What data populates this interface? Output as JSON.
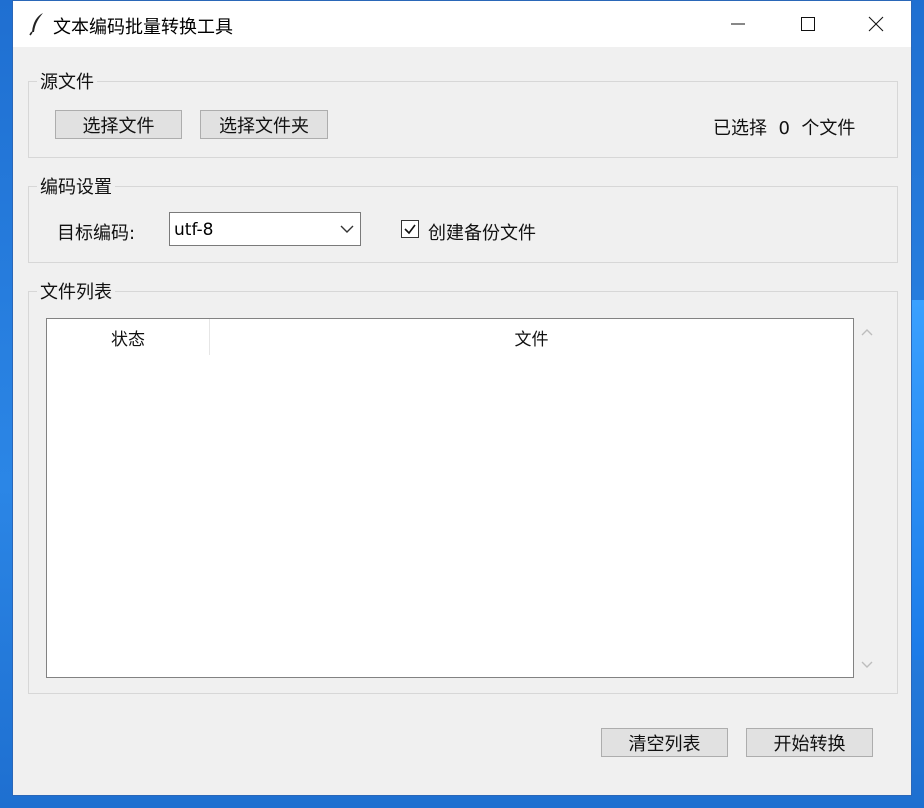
{
  "window": {
    "title": "文本编码批量转换工具",
    "icons": {
      "app": "feather-icon",
      "minimize": "minimize-icon",
      "maximize": "maximize-icon",
      "close": "close-icon"
    }
  },
  "source": {
    "group_label": "源文件",
    "select_files_label": "选择文件",
    "select_folder_label": "选择文件夹",
    "selected_count_text": "已选择  0  个文件"
  },
  "encoding": {
    "group_label": "编码设置",
    "target_label": "目标编码:",
    "target_value": "utf-8",
    "backup_label": "创建备份文件",
    "backup_checked": true
  },
  "file_list": {
    "group_label": "文件列表",
    "columns": [
      "状态",
      "文件"
    ],
    "rows": []
  },
  "actions": {
    "clear_label": "清空列表",
    "start_label": "开始转换"
  },
  "colors": {
    "desktop": "#1f6fd1",
    "window_bg": "#f0f0f0",
    "button_bg": "#e1e1e1"
  }
}
